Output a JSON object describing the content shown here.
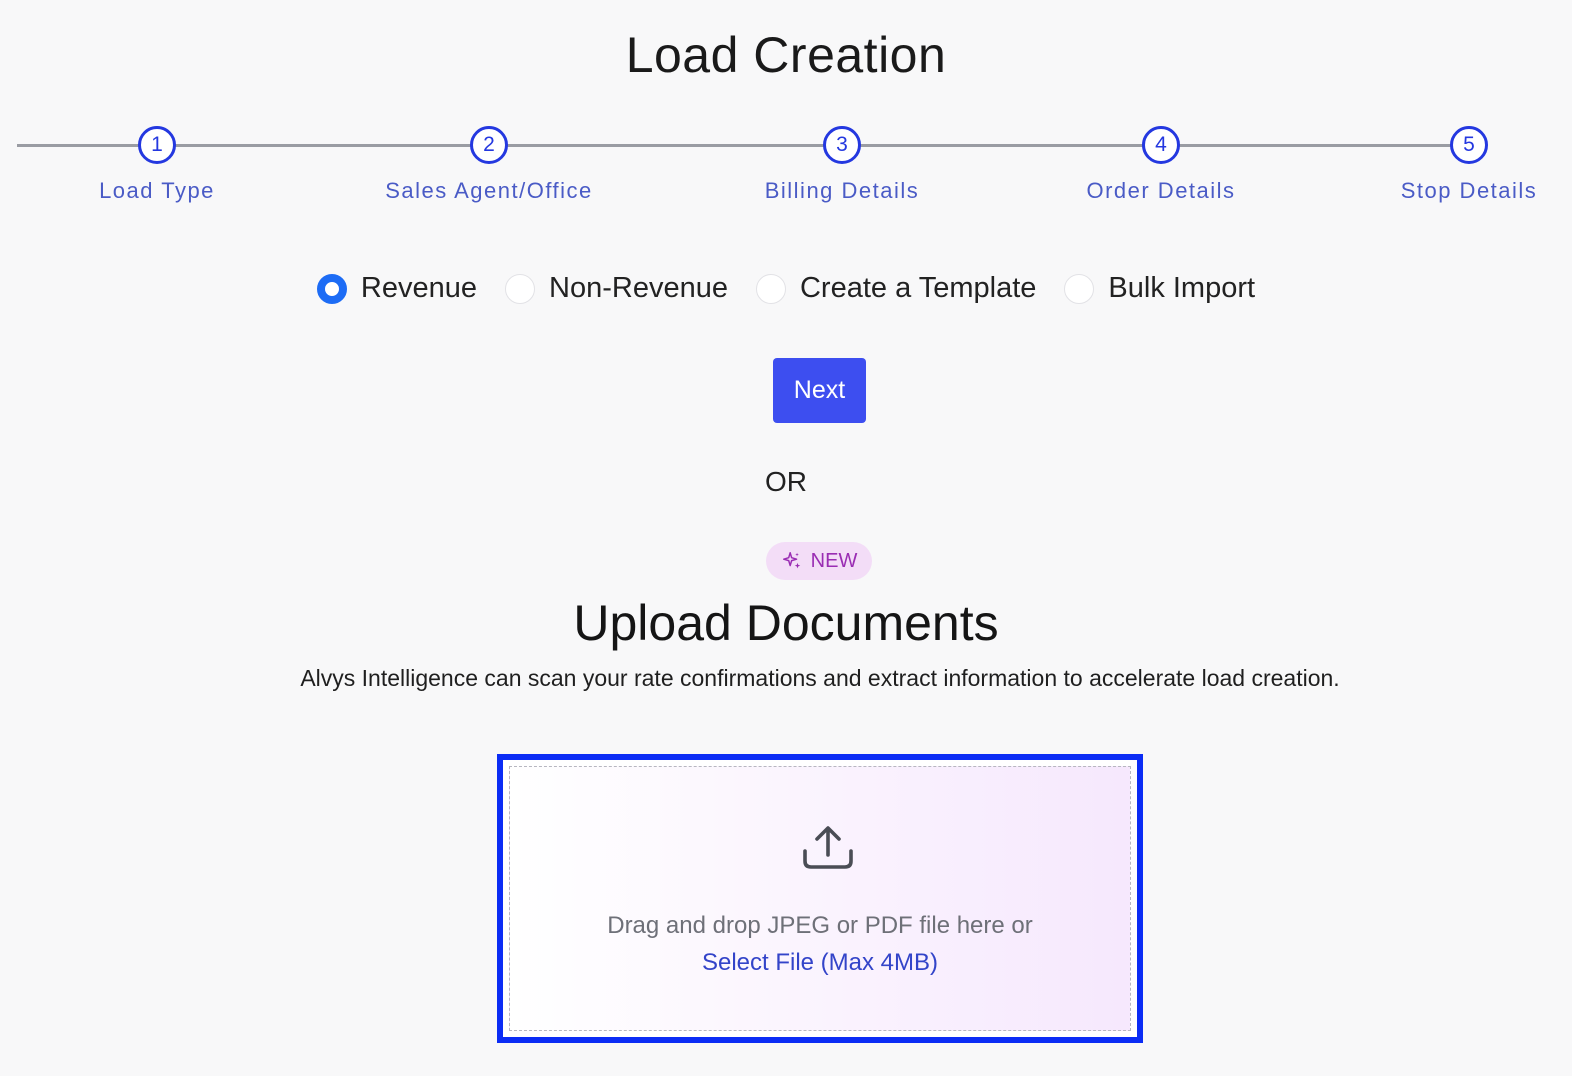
{
  "header": {
    "title": "Load Creation"
  },
  "stepper": {
    "steps": [
      {
        "number": "1",
        "label": "Load Type"
      },
      {
        "number": "2",
        "label": "Sales Agent/Office"
      },
      {
        "number": "3",
        "label": "Billing Details"
      },
      {
        "number": "4",
        "label": "Order Details"
      },
      {
        "number": "5",
        "label": "Stop Details"
      }
    ]
  },
  "load_type": {
    "options": [
      {
        "label": "Revenue",
        "checked": true
      },
      {
        "label": "Non-Revenue",
        "checked": false
      },
      {
        "label": "Create a Template",
        "checked": false
      },
      {
        "label": "Bulk Import",
        "checked": false
      }
    ]
  },
  "actions": {
    "next_label": "Next",
    "or_label": "OR"
  },
  "upload": {
    "badge": {
      "label": "NEW",
      "icon": "sparkle-icon"
    },
    "title": "Upload Documents",
    "description": "Alvys Intelligence can scan your rate confirmations and extract information to accelerate load creation.",
    "drop_text": "Drag and drop JPEG or PDF file here or",
    "select_link": "Select File (Max 4MB)",
    "icon": "upload-icon"
  },
  "colors": {
    "accent": "#3d4ef0",
    "step_accent": "#2438e0",
    "radio_checked": "#1d6cf5",
    "badge_bg": "#f3ddf7",
    "badge_text": "#9a2db3",
    "highlight_border": "#0b2cf5"
  }
}
